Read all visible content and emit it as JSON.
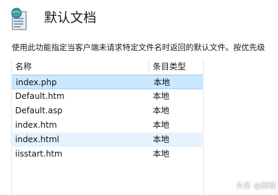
{
  "header": {
    "title": "默认文档",
    "icon": "default-document-icon"
  },
  "description": "使用此功能指定当客户端未请求特定文件名时返回的默认文件。按优先级",
  "table": {
    "columns": [
      "名称",
      "条目类型"
    ],
    "rows": [
      {
        "name": "index.php",
        "type": "本地"
      },
      {
        "name": "Default.htm",
        "type": "本地"
      },
      {
        "name": "Default.asp",
        "type": "本地"
      },
      {
        "name": "index.htm",
        "type": "本地"
      },
      {
        "name": "index.html",
        "type": "本地"
      },
      {
        "name": "iisstart.htm",
        "type": "本地"
      }
    ]
  },
  "watermark": "头条 @腾锋",
  "colors": {
    "selected_row": "#cce8ff",
    "hover_row": "#e5f3ff",
    "selected_border": "#99d1ff"
  }
}
